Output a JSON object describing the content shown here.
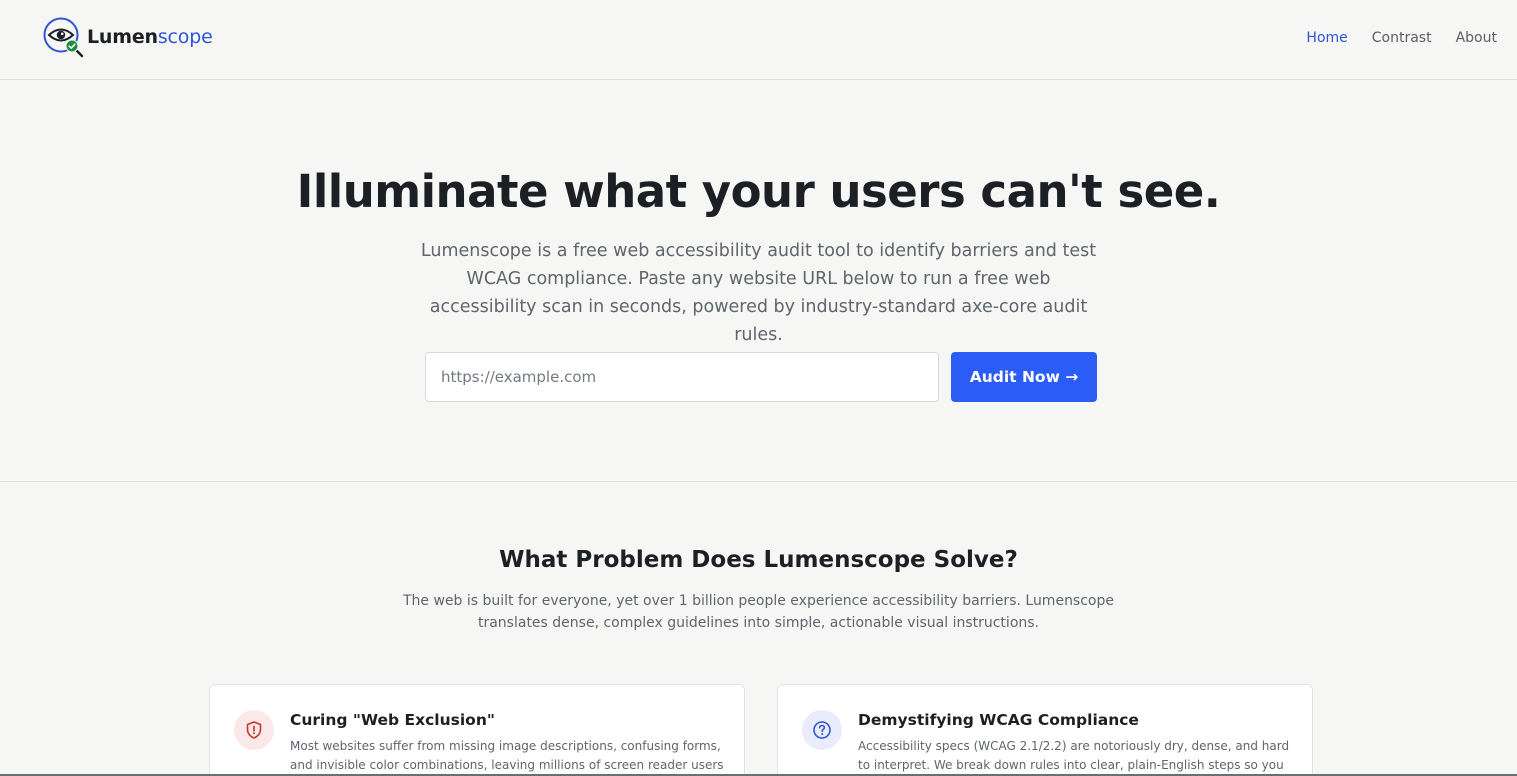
{
  "header": {
    "brand": {
      "name_main": "Lumen",
      "name_accent": "scope",
      "logo_icon": "eye-magnifier-check-icon"
    },
    "nav": [
      {
        "label": "Home",
        "active": true
      },
      {
        "label": "Contrast",
        "active": false
      },
      {
        "label": "About",
        "active": false
      }
    ]
  },
  "hero": {
    "title": "Illuminate what your users can't see.",
    "subtitle": "Lumenscope is a free web accessibility audit tool to identify barriers and test WCAG compliance. Paste any website URL below to run a free web accessibility scan in seconds, powered by industry-standard axe-core audit rules.",
    "url_input": {
      "value": "",
      "placeholder": "https://example.com"
    },
    "audit_button_label": "Audit Now →"
  },
  "problem": {
    "title": "What Problem Does Lumenscope Solve?",
    "subtitle": "The web is built for everyone, yet over 1 billion people experience accessibility barriers. Lumenscope translates dense, complex guidelines into simple, actionable visual instructions.",
    "cards": [
      {
        "icon": "shield-alert-icon",
        "title": "Curing \"Web Exclusion\"",
        "text": "Most websites suffer from missing image descriptions, confusing forms, and invisible color combinations, leaving millions of screen reader users and visually"
      },
      {
        "icon": "question-circle-icon",
        "title": "Demystifying WCAG Compliance",
        "text": "Accessibility specs (WCAG 2.1/2.2) are notoriously dry, dense, and hard to interpret. We break down rules into clear, plain-English steps so you know"
      }
    ]
  },
  "colors": {
    "accent": "#2f55d4",
    "button": "#2c5cf6",
    "danger_icon": "#c0392b",
    "info_icon": "#2f55d4",
    "check_badge": "#1e8e3e"
  }
}
